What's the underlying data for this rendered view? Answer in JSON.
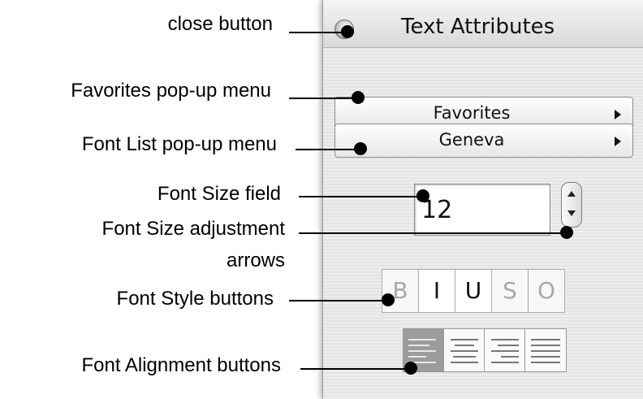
{
  "callouts": {
    "close": "close button",
    "favorites": "Favorites pop-up menu",
    "font_list": "Font List pop-up menu",
    "font_size": "Font Size field",
    "adjust_line1": "Font Size adjustment",
    "adjust_line2": "arrows",
    "styles": "Font Style buttons",
    "alignment": "Font Alignment buttons"
  },
  "palette": {
    "title": "Text Attributes",
    "favorites_menu": "Favorites",
    "font_menu": "Geneva",
    "font_size": "12",
    "style_buttons": [
      "B",
      "I",
      "U",
      "S",
      "O"
    ],
    "style_enabled": [
      false,
      true,
      true,
      false,
      false
    ],
    "alignment_buttons": [
      "left",
      "center",
      "right",
      "justify"
    ],
    "alignment_selected": "left"
  }
}
